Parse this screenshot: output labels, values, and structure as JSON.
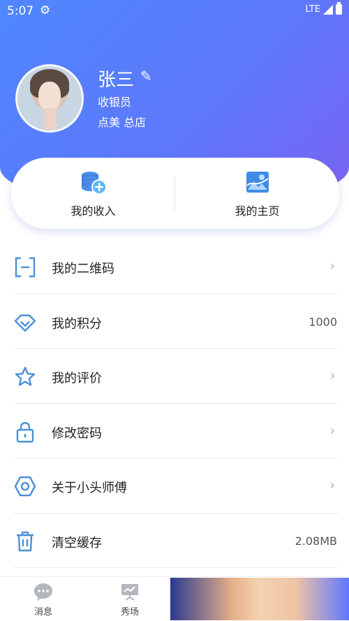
{
  "status": {
    "time": "5:07",
    "network": "LTE"
  },
  "profile": {
    "name": "张三",
    "role": "收银员",
    "store": "点美  总店"
  },
  "quick": [
    {
      "label": "我的收入",
      "icon": "coins-add-icon"
    },
    {
      "label": "我的主页",
      "icon": "landscape-image-icon"
    }
  ],
  "menu": [
    {
      "label": "我的二维码",
      "icon": "qr-scan-icon",
      "value": "",
      "chevron": "›"
    },
    {
      "label": "我的积分",
      "icon": "diamond-icon",
      "value": "1000",
      "chevron": ""
    },
    {
      "label": "我的评价",
      "icon": "star-icon",
      "value": "",
      "chevron": "›"
    },
    {
      "label": "修改密码",
      "icon": "lock-icon",
      "value": "",
      "chevron": "›"
    },
    {
      "label": "关于小头师傅",
      "icon": "hexagon-icon",
      "value": "",
      "chevron": "›"
    },
    {
      "label": "清空缓存",
      "icon": "trash-icon",
      "value": "2.08MB",
      "chevron": ""
    }
  ],
  "tabs": [
    {
      "label": "消息",
      "icon": "chat-bubble-icon"
    },
    {
      "label": "秀场",
      "icon": "presentation-icon"
    }
  ],
  "colors": {
    "accent": "#4a90d9",
    "header_start": "#4f87ff",
    "header_end": "#7b63f3"
  }
}
